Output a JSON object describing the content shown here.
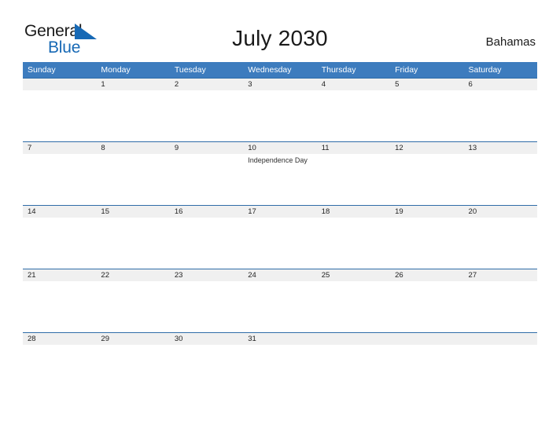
{
  "brand": {
    "name_part1": "General",
    "name_part2": "Blue",
    "logo_icon": "flag-triangle-icon",
    "color_primary": "#1769b5",
    "color_text": "#1a1a1a"
  },
  "header": {
    "title": "July 2030",
    "country": "Bahamas"
  },
  "theme": {
    "header_blue": "#3d7cbe",
    "cell_border_blue": "#2f6ca8",
    "date_band_gray": "#f0f0f0",
    "page_background": "#ffffff"
  },
  "calendar": {
    "weekday_headers": [
      "Sunday",
      "Monday",
      "Tuesday",
      "Wednesday",
      "Thursday",
      "Friday",
      "Saturday"
    ],
    "weeks": [
      [
        {
          "day": "",
          "events": []
        },
        {
          "day": "1",
          "events": []
        },
        {
          "day": "2",
          "events": []
        },
        {
          "day": "3",
          "events": []
        },
        {
          "day": "4",
          "events": []
        },
        {
          "day": "5",
          "events": []
        },
        {
          "day": "6",
          "events": []
        }
      ],
      [
        {
          "day": "7",
          "events": []
        },
        {
          "day": "8",
          "events": []
        },
        {
          "day": "9",
          "events": []
        },
        {
          "day": "10",
          "events": [
            "Independence Day"
          ]
        },
        {
          "day": "11",
          "events": []
        },
        {
          "day": "12",
          "events": []
        },
        {
          "day": "13",
          "events": []
        }
      ],
      [
        {
          "day": "14",
          "events": []
        },
        {
          "day": "15",
          "events": []
        },
        {
          "day": "16",
          "events": []
        },
        {
          "day": "17",
          "events": []
        },
        {
          "day": "18",
          "events": []
        },
        {
          "day": "19",
          "events": []
        },
        {
          "day": "20",
          "events": []
        }
      ],
      [
        {
          "day": "21",
          "events": []
        },
        {
          "day": "22",
          "events": []
        },
        {
          "day": "23",
          "events": []
        },
        {
          "day": "24",
          "events": []
        },
        {
          "day": "25",
          "events": []
        },
        {
          "day": "26",
          "events": []
        },
        {
          "day": "27",
          "events": []
        }
      ],
      [
        {
          "day": "28",
          "events": []
        },
        {
          "day": "29",
          "events": []
        },
        {
          "day": "30",
          "events": []
        },
        {
          "day": "31",
          "events": []
        },
        {
          "day": "",
          "events": []
        },
        {
          "day": "",
          "events": []
        },
        {
          "day": "",
          "events": []
        }
      ]
    ]
  }
}
